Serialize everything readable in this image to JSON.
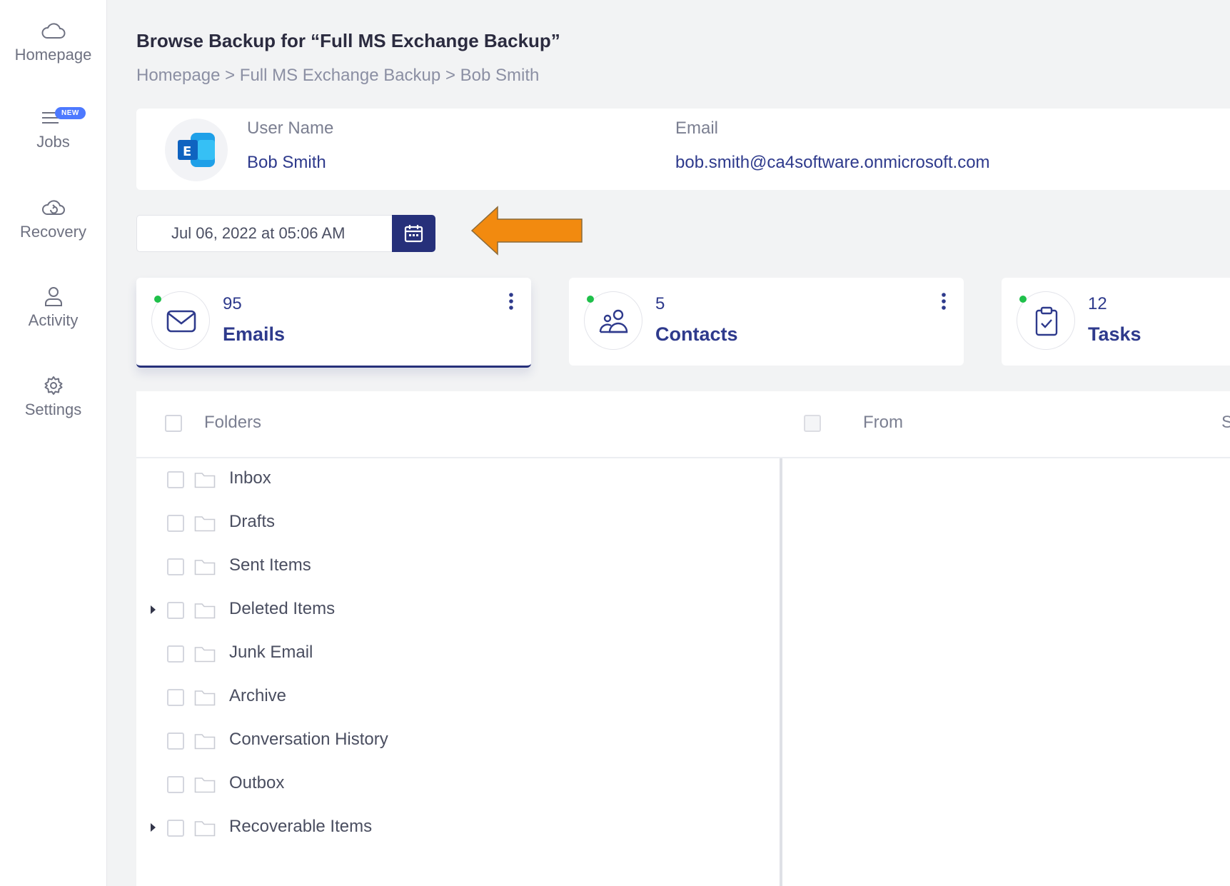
{
  "sidebar": {
    "items": [
      {
        "label": "Homepage",
        "icon": "cloud-icon"
      },
      {
        "label": "Jobs",
        "icon": "list-icon",
        "badge": "NEW"
      },
      {
        "label": "Recovery",
        "icon": "cloud-recovery-icon"
      },
      {
        "label": "Activity",
        "icon": "user-icon"
      },
      {
        "label": "Settings",
        "icon": "gear-icon"
      }
    ]
  },
  "header": {
    "title": "Browse Backup for “Full MS Exchange Backup”",
    "breadcrumb": [
      "Homepage",
      "Full MS Exchange Backup",
      "Bob Smith"
    ],
    "breadcrumb_sep": ">"
  },
  "user": {
    "name_label": "User Name",
    "name": "Bob Smith",
    "email_label": "Email",
    "email": "bob.smith@ca4software.onmicrosoft.com",
    "avatar_icon": "exchange-logo-icon"
  },
  "backup_date": {
    "value": "Jul 06, 2022 at 05:06 AM",
    "button_icon": "calendar-icon"
  },
  "categories": [
    {
      "count": "95",
      "label": "Emails",
      "icon": "mail-icon",
      "active": true
    },
    {
      "count": "5",
      "label": "Contacts",
      "icon": "contacts-icon",
      "active": false
    },
    {
      "count": "12",
      "label": "Tasks",
      "icon": "clipboard-check-icon",
      "active": false
    }
  ],
  "table": {
    "headers": [
      "Folders",
      "From",
      "S"
    ]
  },
  "folders": [
    {
      "name": "Inbox",
      "expandable": false
    },
    {
      "name": "Drafts",
      "expandable": false
    },
    {
      "name": "Sent Items",
      "expandable": false
    },
    {
      "name": "Deleted Items",
      "expandable": true
    },
    {
      "name": "Junk Email",
      "expandable": false
    },
    {
      "name": "Archive",
      "expandable": false
    },
    {
      "name": "Conversation History",
      "expandable": false
    },
    {
      "name": "Outbox",
      "expandable": false
    },
    {
      "name": "Recoverable Items",
      "expandable": true
    }
  ],
  "colors": {
    "accent": "#26307a",
    "arrow": "#f28a0f",
    "online_dot": "#1fc04a",
    "badge": "#4d79ff"
  }
}
